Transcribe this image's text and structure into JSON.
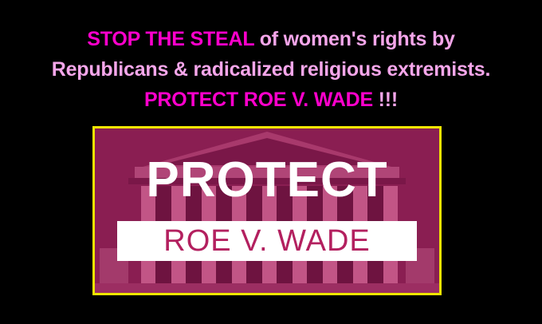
{
  "headline": {
    "line1_hot": "STOP THE STEAL",
    "line1_soft": " of women's rights by",
    "line2": "Republicans & radicalized religious extremists.",
    "line3_hot": "PROTECT ROE V. WADE",
    "line3_soft": " !!!"
  },
  "poster": {
    "big_text": "PROTECT",
    "banner_text": "ROE V. WADE"
  },
  "colors": {
    "background": "#000000",
    "hot_pink": "#ff00cc",
    "soft_pink": "#f5a6ea",
    "poster_tint": "#8a1e52",
    "frame": "#f2e600"
  }
}
